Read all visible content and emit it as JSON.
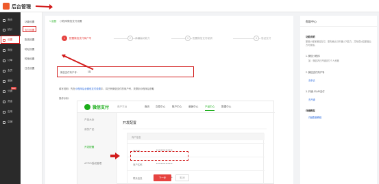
{
  "app": {
    "brand": "后台管理",
    "accent": "#e64340",
    "annotation": "#d21d1d"
  },
  "sidebar": {
    "items": [
      {
        "label": "首页",
        "icon": "home-icon"
      },
      {
        "label": "统计",
        "icon": "chart-icon"
      },
      {
        "label": "设置",
        "icon": "gear-icon",
        "active": true
      },
      {
        "label": "商品",
        "icon": "box-icon"
      },
      {
        "label": "订单",
        "icon": "list-icon"
      },
      {
        "label": "会员",
        "icon": "user-icon"
      },
      {
        "label": "营销",
        "icon": "tag-icon"
      },
      {
        "label": "分销",
        "icon": "share-icon",
        "badge": "New"
      },
      {
        "label": "资金",
        "icon": "wallet-icon"
      },
      {
        "label": "应用",
        "icon": "grid-icon"
      },
      {
        "label": "店铺",
        "icon": "store-icon"
      }
    ]
  },
  "submenu": {
    "items": [
      {
        "label": "功能设置"
      },
      {
        "label": "支付设置",
        "active": true
      },
      {
        "label": "配送设置"
      },
      {
        "label": "地址设置"
      },
      {
        "label": "短信设置"
      },
      {
        "label": "日志设置"
      }
    ]
  },
  "main": {
    "back_label": "< 返回",
    "breadcrumb": "小程序微信支付设置",
    "steps": [
      {
        "num": "1",
        "label": "配置微信支付商户号",
        "active": true
      },
      {
        "num": "2",
        "label": "开通支付能力"
      },
      {
        "num": "3",
        "label": "配置微信支付秘钥"
      },
      {
        "num": "4",
        "label": "验证支付"
      }
    ],
    "field": {
      "label": "微信支付商户号：",
      "value": "111"
    },
    "tip_prefix": "填写说明：先在",
    "tip_link": "小程序后台微信支付设置",
    "tip_suffix": "中，将已有微信支付的商户号，关联到小程序后获取",
    "tip2": "操作示例："
  },
  "wx": {
    "brand": "微信支付",
    "platform": "商户平台",
    "nav": [
      "首页",
      "交易中心",
      "账户中心",
      "营销中心",
      "产品中心",
      "数据中心"
    ],
    "nav_active": 4,
    "side": [
      "产品大全",
      "我的产品",
      "开发配置",
      "APPID授权管理"
    ],
    "side_active": 2,
    "page_title": "开发配置",
    "table_head": "商户信息",
    "rows": [
      {
        "key": "商户号",
        "value": "**************"
      },
      {
        "key": "商户名称",
        "value": "**************"
      },
      {
        "key": "联系信息",
        "value": "**************"
      }
    ]
  },
  "buttons": {
    "next": "下一步",
    "cancel": "取消"
  },
  "help": {
    "title": "帮助中心",
    "sec1_title": "功能说明",
    "sec1_text": "配置小程序微信支付，需先确认已开通以下能力，并完成对应配置后方可使用。",
    "item1": "1. 微信小程序",
    "item1_text": "如：微信内已开通支付个人资格",
    "item2": "2. 微信支付商户号",
    "item2_link": "去申请",
    "item3": "3. 开通 JSAPI支付",
    "item3_link": "去开通",
    "sec2_title": "详细教程",
    "sec2_link": "详细配置教程"
  }
}
